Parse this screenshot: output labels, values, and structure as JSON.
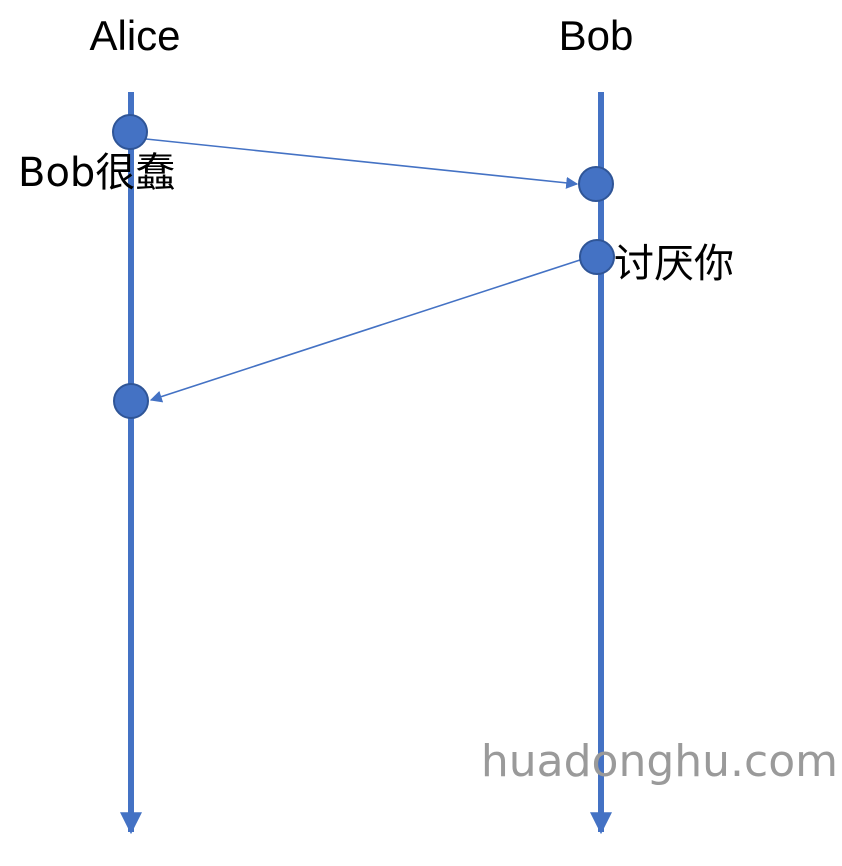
{
  "participants": {
    "alice": {
      "name": "Alice"
    },
    "bob": {
      "name": "Bob"
    }
  },
  "messages": [
    {
      "from": "alice",
      "to": "bob",
      "label": "Bob很蠢"
    },
    {
      "from": "bob",
      "to": "alice",
      "label": "讨厌你"
    }
  ],
  "watermark": "huadonghu.com",
  "colors": {
    "lifeline": "#4472C4",
    "event_fill": "#4472C4",
    "event_stroke": "#2F5597",
    "text": "#000000",
    "watermark": "#9a9a9a"
  }
}
